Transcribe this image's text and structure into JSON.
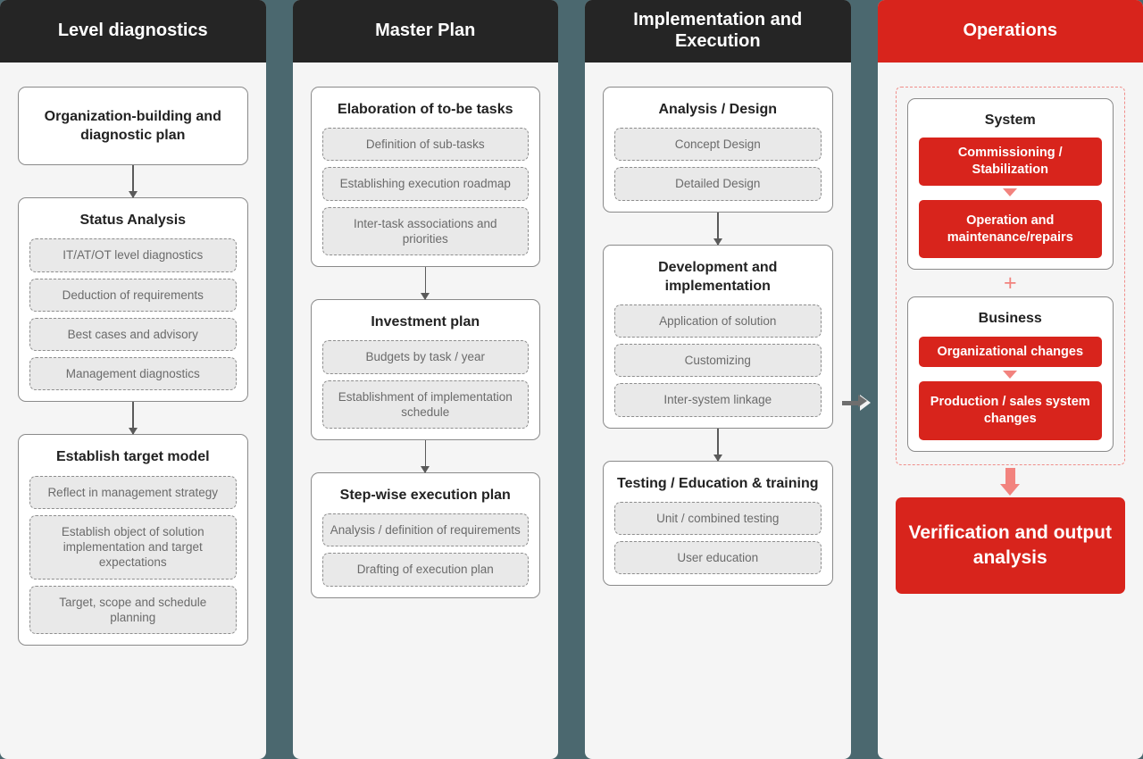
{
  "diagram": {
    "title": "Four-phase project roadmap",
    "colors": {
      "accent_red": "#d8241c",
      "header_dark": "#252525",
      "gap_teal": "#4b686f",
      "panel_bg": "#f5f5f5",
      "chip_bg": "#e9e9e9"
    }
  },
  "columns": [
    {
      "header": "Level diagnostics",
      "groups": [
        {
          "title": "Organization-building and diagnostic plan",
          "items": []
        },
        {
          "title": "Status Analysis",
          "items": [
            "IT/AT/OT level diagnostics",
            "Deduction of requirements",
            "Best cases and advisory",
            "Management diagnostics"
          ]
        },
        {
          "title": "Establish target model",
          "items": [
            "Reflect in management strategy",
            "Establish object of solution implementation and target expectations",
            "Target, scope and schedule planning"
          ]
        }
      ]
    },
    {
      "header": "Master Plan",
      "groups": [
        {
          "title": "Elaboration of to-be tasks",
          "items": [
            "Definition of sub-tasks",
            "Establishing execution roadmap",
            "Inter-task associations and priorities"
          ]
        },
        {
          "title": "Investment plan",
          "items": [
            "Budgets by task / year",
            "Establishment of implementation schedule"
          ]
        },
        {
          "title": "Step-wise execution plan",
          "items": [
            "Analysis / definition of requirements",
            "Drafting of execution plan"
          ]
        }
      ]
    },
    {
      "header": "Implementation and Execution",
      "groups": [
        {
          "title": "Analysis / Design",
          "items": [
            "Concept Design",
            "Detailed Design"
          ]
        },
        {
          "title": "Development and implementation",
          "items": [
            "Application of solution",
            "Customizing",
            "Inter-system linkage"
          ]
        },
        {
          "title": "Testing / Education & training",
          "items": [
            "Unit / combined testing",
            "User education"
          ]
        }
      ]
    },
    {
      "header": "Operations",
      "dashed_group": {
        "cards": [
          {
            "title": "System",
            "steps": [
              "Commissioning / Stabilization",
              "Operation and maintenance/repairs"
            ]
          },
          {
            "title": "Business",
            "steps": [
              "Organizational changes",
              "Production / sales system changes"
            ]
          }
        ],
        "joiner": "+"
      },
      "final": "Verification and output analysis"
    }
  ]
}
